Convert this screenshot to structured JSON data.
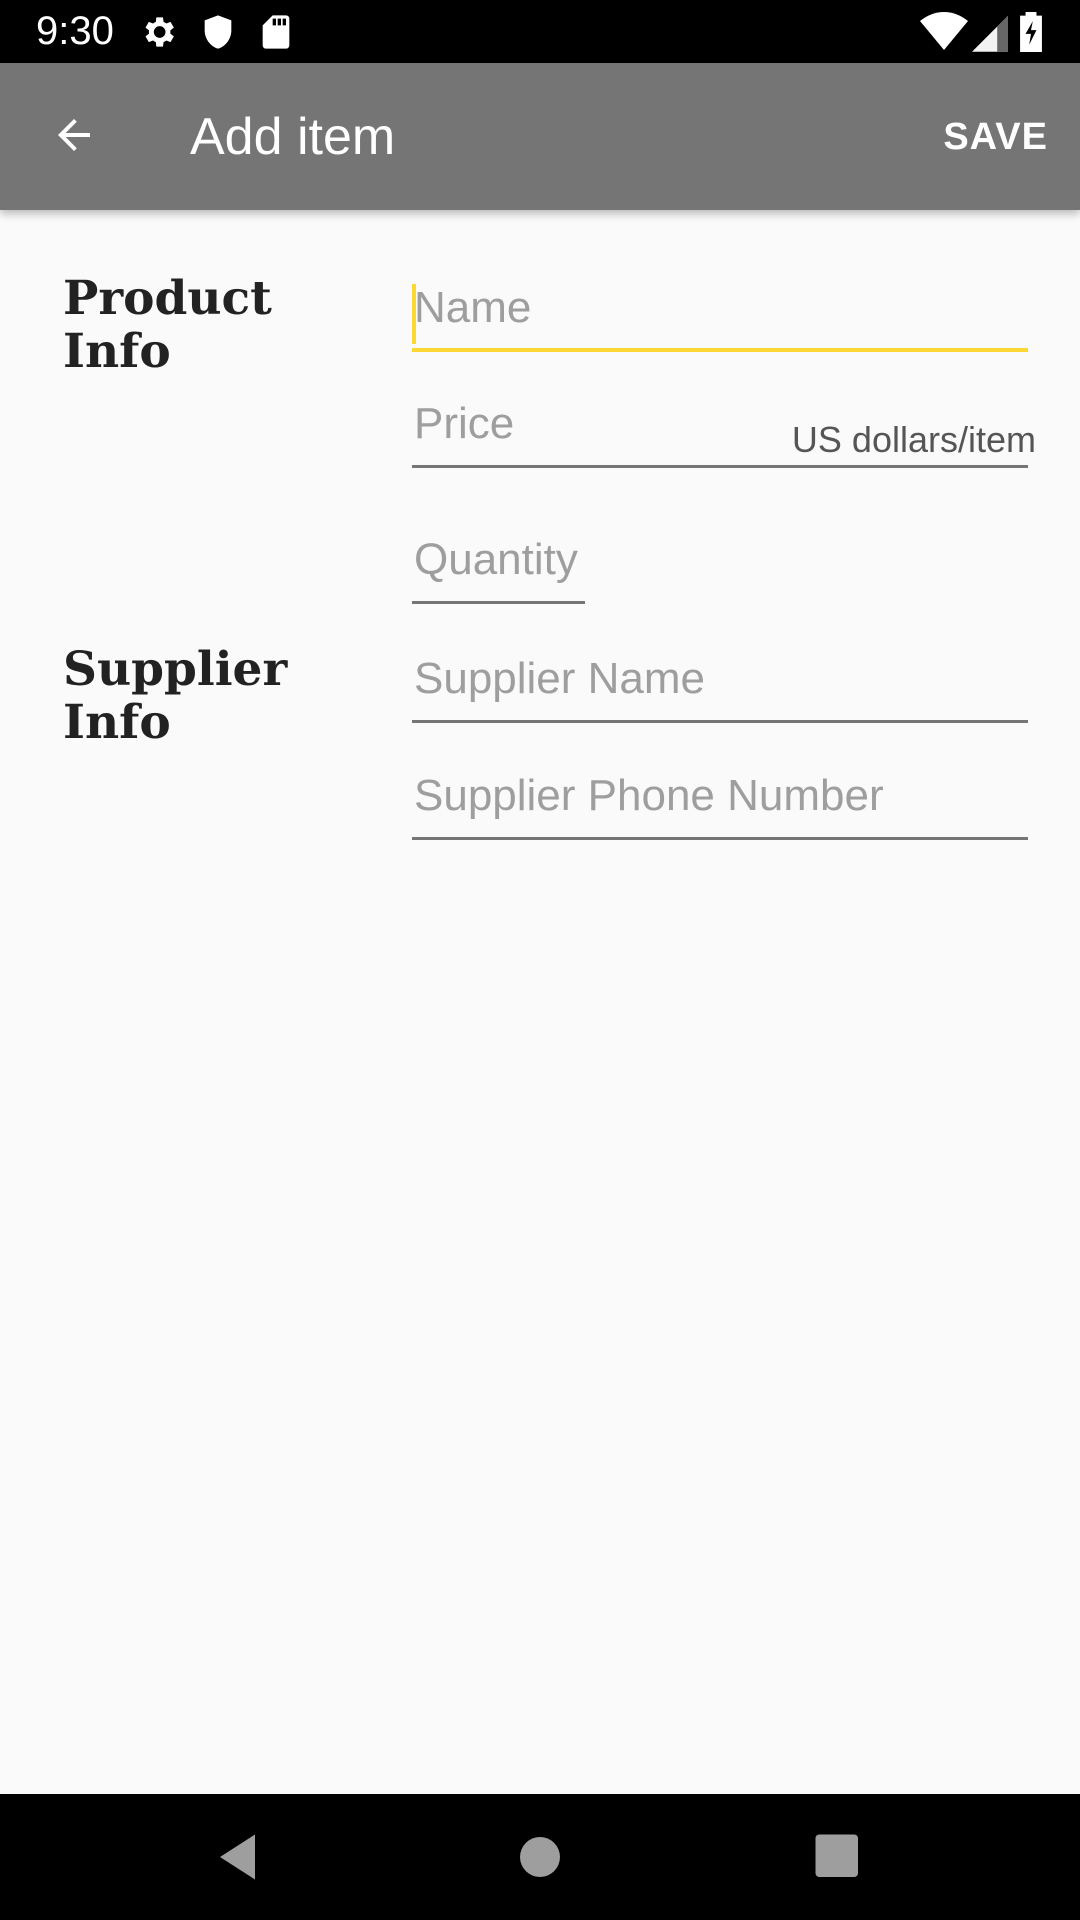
{
  "status_bar": {
    "time": "9:30",
    "icons_left": [
      "gear-icon",
      "shield-icon",
      "sd-card-icon"
    ],
    "icons_right": [
      "wifi-icon",
      "cell-signal-icon",
      "battery-charging-icon"
    ]
  },
  "app_bar": {
    "back_icon": "arrow-back-icon",
    "title": "Add item",
    "save_label": "SAVE"
  },
  "form": {
    "product_section_label": "Product Info",
    "supplier_section_label": "Supplier Info",
    "name_placeholder": "Name",
    "name_value": "",
    "price_placeholder": "Price",
    "price_value": "",
    "price_unit": "US dollars/item",
    "quantity_placeholder": "Quantity",
    "quantity_value": "",
    "supplier_name_placeholder": "Supplier Name",
    "supplier_name_value": "",
    "supplier_phone_placeholder": "Supplier Phone Number",
    "supplier_phone_value": ""
  },
  "colors": {
    "app_bar": "#757575",
    "accent": "#fdd835",
    "background": "#fafafa"
  },
  "nav_bar": {
    "icons": [
      "back-triangle-icon",
      "home-circle-icon",
      "recents-square-icon"
    ]
  }
}
